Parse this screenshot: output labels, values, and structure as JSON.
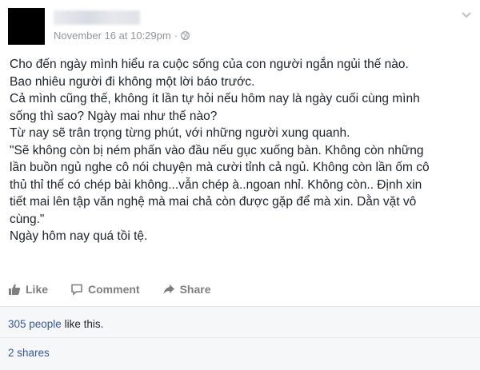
{
  "post": {
    "timestamp": "November 16 at 10:29pm",
    "separator": "·",
    "body_lines": [
      "Cho đến ngày mình hiểu ra cuộc sống của con người ngắn ngủi thế nào.",
      "Bao nhiêu người đi không một lời báo trước.",
      "Cả mình cũng thế, không ít lần tự hỏi nếu hôm nay là ngày cuối cùng mình",
      "sống thì sao? Ngày mai như thế nào?",
      "Từ nay sẽ trân trọng từng phút, với những người xung quanh.",
      "\"Sẽ không còn bị ném phấn vào đầu nếu gục xuống bàn. Không còn những",
      "lần buồn ngủ nghe cô nói chuyện mà cười tỉnh cả ngủ. Không còn lần ốm cô",
      "thủ thỉ thế có chép bài không...vẫn chép à..ngoan nhỉ. Không còn.. Định xin",
      "tiết mai lên tập văn nghệ mà mai chả còn được gặp để mà xin. Dằn vặt vô",
      "cùng.\"",
      "Ngày hôm nay quá tồi tệ."
    ]
  },
  "actions": {
    "like_label": "Like",
    "comment_label": "Comment",
    "share_label": "Share"
  },
  "summary": {
    "likes_count_link": "305 people",
    "likes_suffix": " like this.",
    "shares_label": "2 shares"
  },
  "icons": {
    "globe": "globe-icon",
    "chevron": "chevron-down-icon",
    "like": "thumbs-up-icon",
    "comment": "comment-bubble-icon",
    "share": "share-arrow-icon"
  },
  "colors": {
    "link": "#365899",
    "meta_text": "#90949c",
    "action_text": "#7f7f7f",
    "body_text": "#1d2129",
    "summary_bg": "#f6f7f9"
  }
}
